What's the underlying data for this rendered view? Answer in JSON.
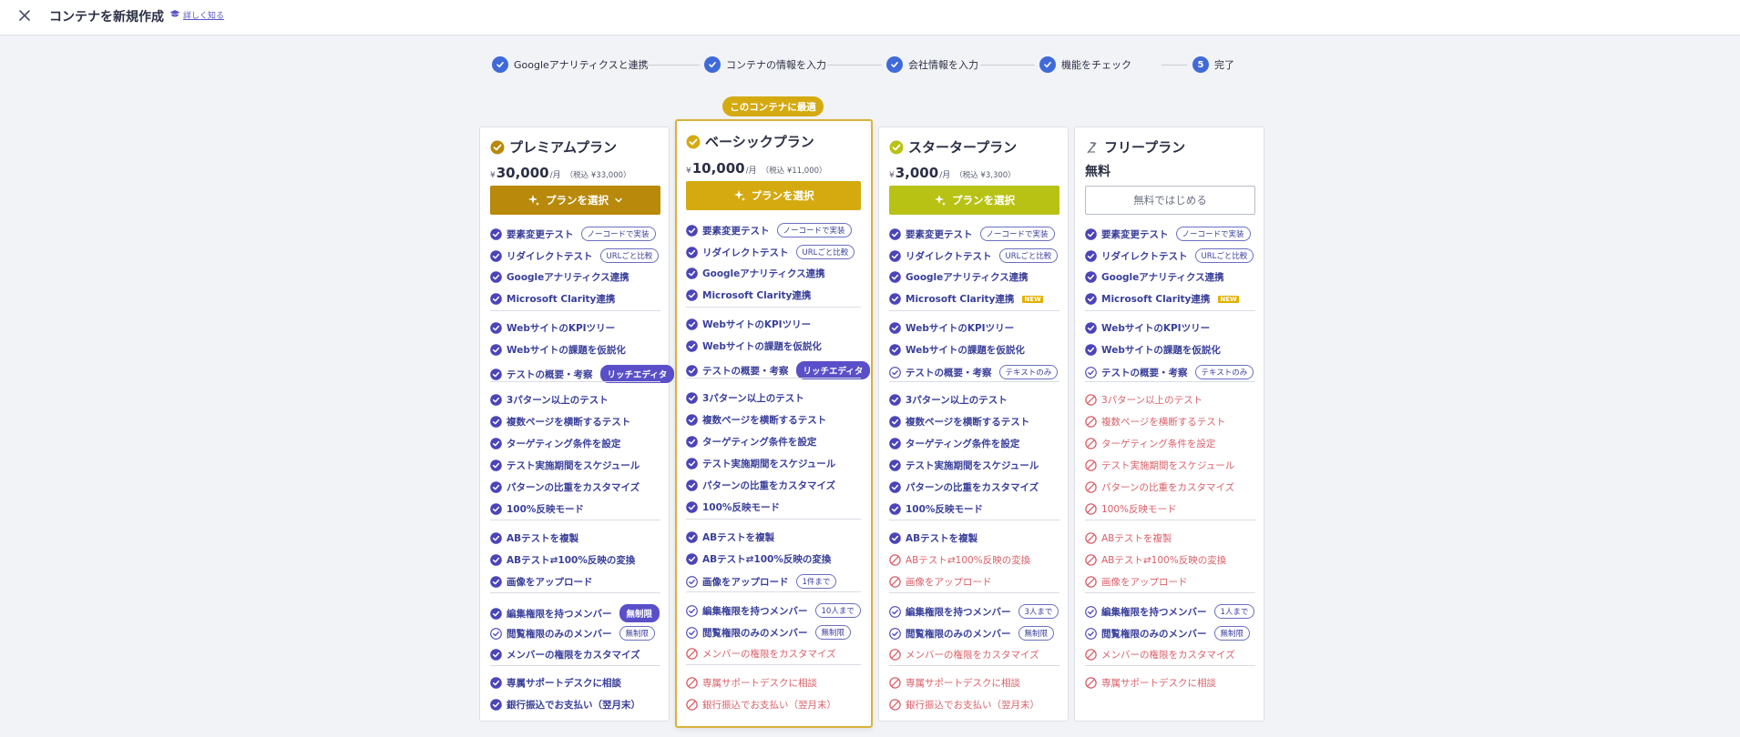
{
  "header": {
    "title": "コンテナを新規作成",
    "learn_more": "詳しく知る"
  },
  "colors": {
    "premium": "#b8890a",
    "basic": "#d4aa10",
    "starter": "#b8c215",
    "check": "#4b45b8",
    "no": "#d9606a",
    "step": "#3f6ad8"
  },
  "steps": [
    {
      "label": "Googleアナリティクスと連携",
      "state": "done"
    },
    {
      "label": "コンテナの情報を入力",
      "state": "done"
    },
    {
      "label": "会社情報を入力",
      "state": "done"
    },
    {
      "label": "機能をチェック",
      "state": "done"
    },
    {
      "label": "完了",
      "state": "current",
      "number": "5"
    }
  ],
  "featured_badge": "このコンテナに最適",
  "plans": [
    {
      "name": "プレミアムプラン",
      "yen": "¥",
      "price": "30,000",
      "per": "/月",
      "tax": "（税込 ¥33,000）",
      "button": "プランを選択",
      "groups": [
        [
          {
            "label": "要素変更テスト",
            "state": "ok",
            "tag": "ノーコードで実装"
          },
          {
            "label": "リダイレクトテスト",
            "state": "ok",
            "tag": "URLごと比較"
          },
          {
            "label": "Googleアナリティクス連携",
            "state": "ok"
          },
          {
            "label": "Microsoft Clarity連携",
            "state": "ok"
          }
        ],
        [
          {
            "label": "WebサイトのKPIツリー",
            "state": "ok"
          },
          {
            "label": "Webサイトの課題を仮説化",
            "state": "ok"
          },
          {
            "label": "テストの概要・考察",
            "state": "ok",
            "tag": "リッチエディタ",
            "tag_style": "filled"
          }
        ],
        [
          {
            "label": "3パターン以上のテスト",
            "state": "ok"
          },
          {
            "label": "複数ページを横断するテスト",
            "state": "ok"
          },
          {
            "label": "ターゲティング条件を設定",
            "state": "ok"
          },
          {
            "label": "テスト実施期間をスケジュール",
            "state": "ok"
          },
          {
            "label": "パターンの比重をカスタマイズ",
            "state": "ok"
          },
          {
            "label": "100%反映モード",
            "state": "ok"
          }
        ],
        [
          {
            "label": "ABテストを複製",
            "state": "ok"
          },
          {
            "label": "ABテスト⇄100%反映の変換",
            "state": "ok"
          },
          {
            "label": "画像をアップロード",
            "state": "ok"
          }
        ],
        [
          {
            "label": "編集権限を持つメンバー",
            "state": "ok",
            "tag": "無制限",
            "tag_style": "filled"
          },
          {
            "label": "閲覧権限のみのメンバー",
            "state": "partial",
            "tag": "無制限"
          },
          {
            "label": "メンバーの権限をカスタマイズ",
            "state": "ok"
          }
        ],
        [
          {
            "label": "専属サポートデスクに相談",
            "state": "ok"
          },
          {
            "label": "銀行振込でお支払い（翌月末）",
            "state": "ok"
          }
        ]
      ]
    },
    {
      "name": "ベーシックプラン",
      "yen": "¥",
      "price": "10,000",
      "per": "/月",
      "tax": "（税込 ¥11,000）",
      "button": "プランを選択",
      "groups": [
        [
          {
            "label": "要素変更テスト",
            "state": "ok",
            "tag": "ノーコードで実装"
          },
          {
            "label": "リダイレクトテスト",
            "state": "ok",
            "tag": "URLごと比較"
          },
          {
            "label": "Googleアナリティクス連携",
            "state": "ok"
          },
          {
            "label": "Microsoft Clarity連携",
            "state": "ok"
          }
        ],
        [
          {
            "label": "WebサイトのKPIツリー",
            "state": "ok"
          },
          {
            "label": "Webサイトの課題を仮説化",
            "state": "ok"
          },
          {
            "label": "テストの概要・考察",
            "state": "ok",
            "tag": "リッチエディタ",
            "tag_style": "filled"
          }
        ],
        [
          {
            "label": "3パターン以上のテスト",
            "state": "ok"
          },
          {
            "label": "複数ページを横断するテスト",
            "state": "ok"
          },
          {
            "label": "ターゲティング条件を設定",
            "state": "ok"
          },
          {
            "label": "テスト実施期間をスケジュール",
            "state": "ok"
          },
          {
            "label": "パターンの比重をカスタマイズ",
            "state": "ok"
          },
          {
            "label": "100%反映モード",
            "state": "ok"
          }
        ],
        [
          {
            "label": "ABテストを複製",
            "state": "ok"
          },
          {
            "label": "ABテスト⇄100%反映の変換",
            "state": "ok"
          },
          {
            "label": "画像をアップロード",
            "state": "partial",
            "tag": "1件まで"
          }
        ],
        [
          {
            "label": "編集権限を持つメンバー",
            "state": "partial",
            "tag": "10人まで"
          },
          {
            "label": "閲覧権限のみのメンバー",
            "state": "partial",
            "tag": "無制限"
          },
          {
            "label": "メンバーの権限をカスタマイズ",
            "state": "no"
          }
        ],
        [
          {
            "label": "専属サポートデスクに相談",
            "state": "no"
          },
          {
            "label": "銀行振込でお支払い（翌月末）",
            "state": "no"
          }
        ]
      ]
    },
    {
      "name": "スタータープラン",
      "yen": "¥",
      "price": "3,000",
      "per": "/月",
      "tax": "（税込 ¥3,300）",
      "button": "プランを選択",
      "groups": [
        [
          {
            "label": "要素変更テスト",
            "state": "ok",
            "tag": "ノーコードで実装"
          },
          {
            "label": "リダイレクトテスト",
            "state": "ok",
            "tag": "URLごと比較"
          },
          {
            "label": "Googleアナリティクス連携",
            "state": "ok"
          },
          {
            "label": "Microsoft Clarity連携",
            "state": "ok",
            "tag": "NEW",
            "tag_style": "new"
          }
        ],
        [
          {
            "label": "WebサイトのKPIツリー",
            "state": "ok"
          },
          {
            "label": "Webサイトの課題を仮説化",
            "state": "ok"
          },
          {
            "label": "テストの概要・考察",
            "state": "partial",
            "tag": "テキストのみ"
          }
        ],
        [
          {
            "label": "3パターン以上のテスト",
            "state": "ok"
          },
          {
            "label": "複数ページを横断するテスト",
            "state": "ok"
          },
          {
            "label": "ターゲティング条件を設定",
            "state": "ok"
          },
          {
            "label": "テスト実施期間をスケジュール",
            "state": "ok"
          },
          {
            "label": "パターンの比重をカスタマイズ",
            "state": "ok"
          },
          {
            "label": "100%反映モード",
            "state": "ok"
          }
        ],
        [
          {
            "label": "ABテストを複製",
            "state": "ok"
          },
          {
            "label": "ABテスト⇄100%反映の変換",
            "state": "no"
          },
          {
            "label": "画像をアップロード",
            "state": "no"
          }
        ],
        [
          {
            "label": "編集権限を持つメンバー",
            "state": "partial",
            "tag": "3人まで"
          },
          {
            "label": "閲覧権限のみのメンバー",
            "state": "partial",
            "tag": "無制限"
          },
          {
            "label": "メンバーの権限をカスタマイズ",
            "state": "no"
          }
        ],
        [
          {
            "label": "専属サポートデスクに相談",
            "state": "no"
          },
          {
            "label": "銀行振込でお支払い（翌月末）",
            "state": "no"
          }
        ]
      ]
    },
    {
      "name": "フリープラン",
      "free_label": "無料",
      "button": "無料ではじめる",
      "groups": [
        [
          {
            "label": "要素変更テスト",
            "state": "ok",
            "tag": "ノーコードで実装"
          },
          {
            "label": "リダイレクトテスト",
            "state": "ok",
            "tag": "URLごと比較"
          },
          {
            "label": "Googleアナリティクス連携",
            "state": "ok"
          },
          {
            "label": "Microsoft Clarity連携",
            "state": "ok",
            "tag": "NEW",
            "tag_style": "new"
          }
        ],
        [
          {
            "label": "WebサイトのKPIツリー",
            "state": "ok"
          },
          {
            "label": "Webサイトの課題を仮説化",
            "state": "ok"
          },
          {
            "label": "テストの概要・考察",
            "state": "partial",
            "tag": "テキストのみ"
          }
        ],
        [
          {
            "label": "3パターン以上のテスト",
            "state": "no"
          },
          {
            "label": "複数ページを横断するテスト",
            "state": "no"
          },
          {
            "label": "ターゲティング条件を設定",
            "state": "no"
          },
          {
            "label": "テスト実施期間をスケジュール",
            "state": "no"
          },
          {
            "label": "パターンの比重をカスタマイズ",
            "state": "no"
          },
          {
            "label": "100%反映モード",
            "state": "no"
          }
        ],
        [
          {
            "label": "ABテストを複製",
            "state": "no"
          },
          {
            "label": "ABテスト⇄100%反映の変換",
            "state": "no"
          },
          {
            "label": "画像をアップロード",
            "state": "no"
          }
        ],
        [
          {
            "label": "編集権限を持つメンバー",
            "state": "partial",
            "tag": "1人まで"
          },
          {
            "label": "閲覧権限のみのメンバー",
            "state": "partial",
            "tag": "無制限"
          },
          {
            "label": "メンバーの権限をカスタマイズ",
            "state": "no"
          }
        ],
        [
          {
            "label": "専属サポートデスクに相談",
            "state": "no"
          }
        ]
      ]
    }
  ]
}
